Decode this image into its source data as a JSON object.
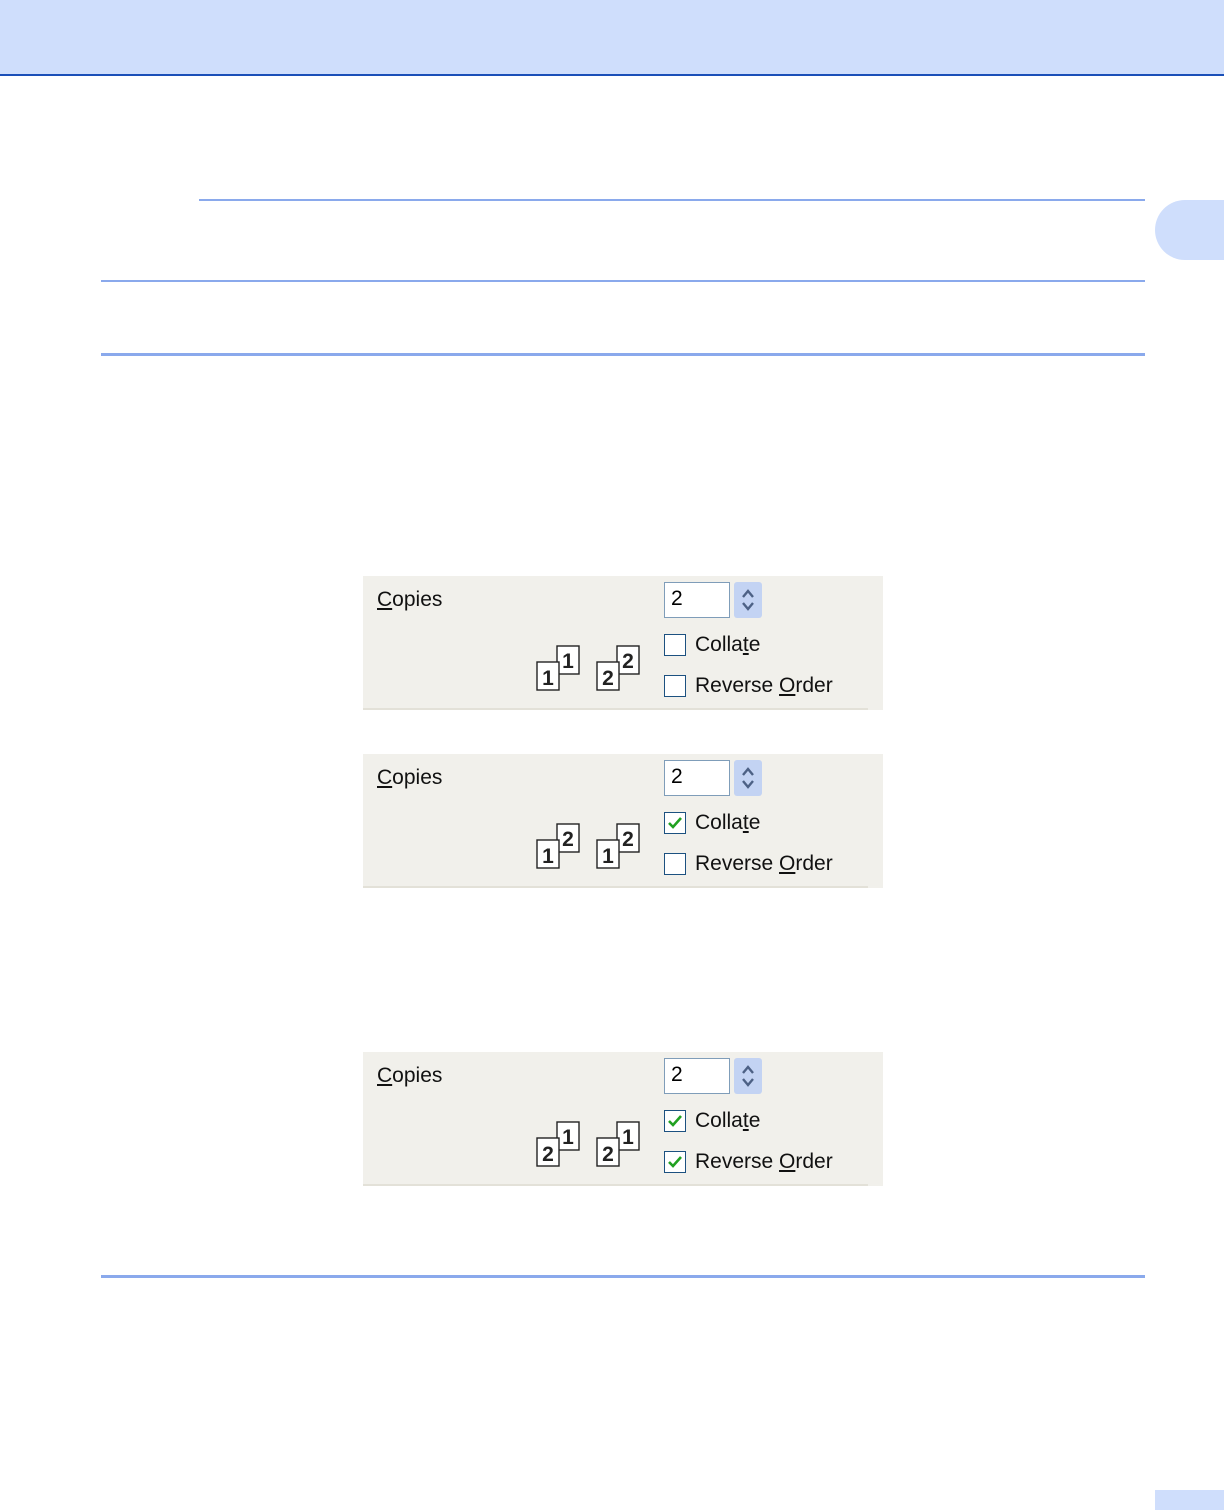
{
  "copies_panels": [
    {
      "copies_label_pre": "",
      "copies_label_u": "C",
      "copies_label_post": "opies",
      "copies_value": "2",
      "collate": {
        "pre": "Colla",
        "u": "t",
        "post": "e",
        "checked": false
      },
      "reverse": {
        "pre": "Reverse ",
        "u": "O",
        "post": "rder",
        "checked": false
      },
      "icon_digits": {
        "stack1_front": "1",
        "stack1_back": "1",
        "stack2_front": "2",
        "stack2_back": "2"
      }
    },
    {
      "copies_label_pre": "",
      "copies_label_u": "C",
      "copies_label_post": "opies",
      "copies_value": "2",
      "collate": {
        "pre": "Colla",
        "u": "t",
        "post": "e",
        "checked": true
      },
      "reverse": {
        "pre": "Reverse ",
        "u": "O",
        "post": "rder",
        "checked": false
      },
      "icon_digits": {
        "stack1_front": "1",
        "stack1_back": "2",
        "stack2_front": "1",
        "stack2_back": "2"
      }
    },
    {
      "copies_label_pre": "",
      "copies_label_u": "C",
      "copies_label_post": "opies",
      "copies_value": "2",
      "collate": {
        "pre": "Colla",
        "u": "t",
        "post": "e",
        "checked": true
      },
      "reverse": {
        "pre": "Reverse ",
        "u": "O",
        "post": "rder",
        "checked": true
      },
      "icon_digits": {
        "stack1_front": "2",
        "stack1_back": "1",
        "stack2_front": "2",
        "stack2_back": "1"
      }
    }
  ],
  "colors": {
    "header_band": "#cfdefc",
    "header_line": "#1a4fb8",
    "rule": "#8aa9ec",
    "panel_bg": "#f1f0eb",
    "check_mark": "#21a121"
  }
}
